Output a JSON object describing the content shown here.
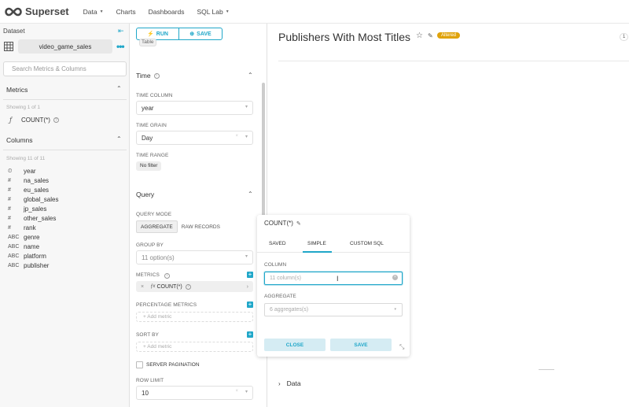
{
  "brand": {
    "name": "Superset"
  },
  "nav": {
    "items": [
      {
        "label": "Data",
        "has_caret": true
      },
      {
        "label": "Charts",
        "has_caret": false
      },
      {
        "label": "Dashboards",
        "has_caret": false
      },
      {
        "label": "SQL Lab",
        "has_caret": true
      }
    ]
  },
  "datasource": {
    "header": "Dataset",
    "name": "video_game_sales",
    "search_placeholder": "Search Metrics & Columns"
  },
  "metrics_section": {
    "title": "Metrics",
    "showing": "Showing 1 of 1",
    "items": [
      {
        "symbol": "ƒ",
        "name": "COUNT(*)"
      }
    ]
  },
  "columns_section": {
    "title": "Columns",
    "showing": "Showing 11 of 11",
    "items": [
      {
        "type": "⏲",
        "name": "year"
      },
      {
        "type": "#",
        "name": "na_sales"
      },
      {
        "type": "#",
        "name": "eu_sales"
      },
      {
        "type": "#",
        "name": "global_sales"
      },
      {
        "type": "#",
        "name": "jp_sales"
      },
      {
        "type": "#",
        "name": "other_sales"
      },
      {
        "type": "#",
        "name": "rank"
      },
      {
        "type": "ABC",
        "name": "genre"
      },
      {
        "type": "ABC",
        "name": "name"
      },
      {
        "type": "ABC",
        "name": "platform"
      },
      {
        "type": "ABC",
        "name": "publisher"
      }
    ]
  },
  "toolbar": {
    "run_label": "RUN",
    "save_label": "SAVE",
    "viz_type": "Table"
  },
  "time_section": {
    "title": "Time",
    "time_column_label": "TIME COLUMN",
    "time_column_value": "year",
    "time_grain_label": "TIME GRAIN",
    "time_grain_value": "Day",
    "time_range_label": "TIME RANGE",
    "time_range_value": "No filter"
  },
  "query_section": {
    "title": "Query",
    "query_mode_label": "QUERY MODE",
    "modes": [
      "AGGREGATE",
      "RAW RECORDS"
    ],
    "active_mode": "AGGREGATE",
    "group_by_label": "GROUP BY",
    "group_by_placeholder": "11 option(s)",
    "metrics_label": "METRICS",
    "metric_value": "COUNT(*)",
    "percentage_metrics_label": "PERCENTAGE METRICS",
    "add_metric_placeholder": "Add metric",
    "sort_by_label": "SORT BY",
    "server_pagination_label": "SERVER PAGINATION",
    "row_limit_label": "ROW LIMIT",
    "row_limit_value": "10"
  },
  "chart_header": {
    "title": "Publishers With Most Titles",
    "status_badge": "Altered",
    "right_badge": "1"
  },
  "data_panel": {
    "label": "Data"
  },
  "metric_popover": {
    "title": "COUNT(*)",
    "tabs": [
      "SAVED",
      "SIMPLE",
      "CUSTOM SQL"
    ],
    "active_tab": "SIMPLE",
    "column_label": "COLUMN",
    "column_placeholder": "11 column(s)",
    "aggregate_label": "AGGREGATE",
    "aggregate_placeholder": "6 aggregates(s)",
    "close_label": "CLOSE",
    "save_label": "SAVE"
  },
  "colors": {
    "accent": "#20a7c9",
    "altered": "#e0a30b"
  }
}
